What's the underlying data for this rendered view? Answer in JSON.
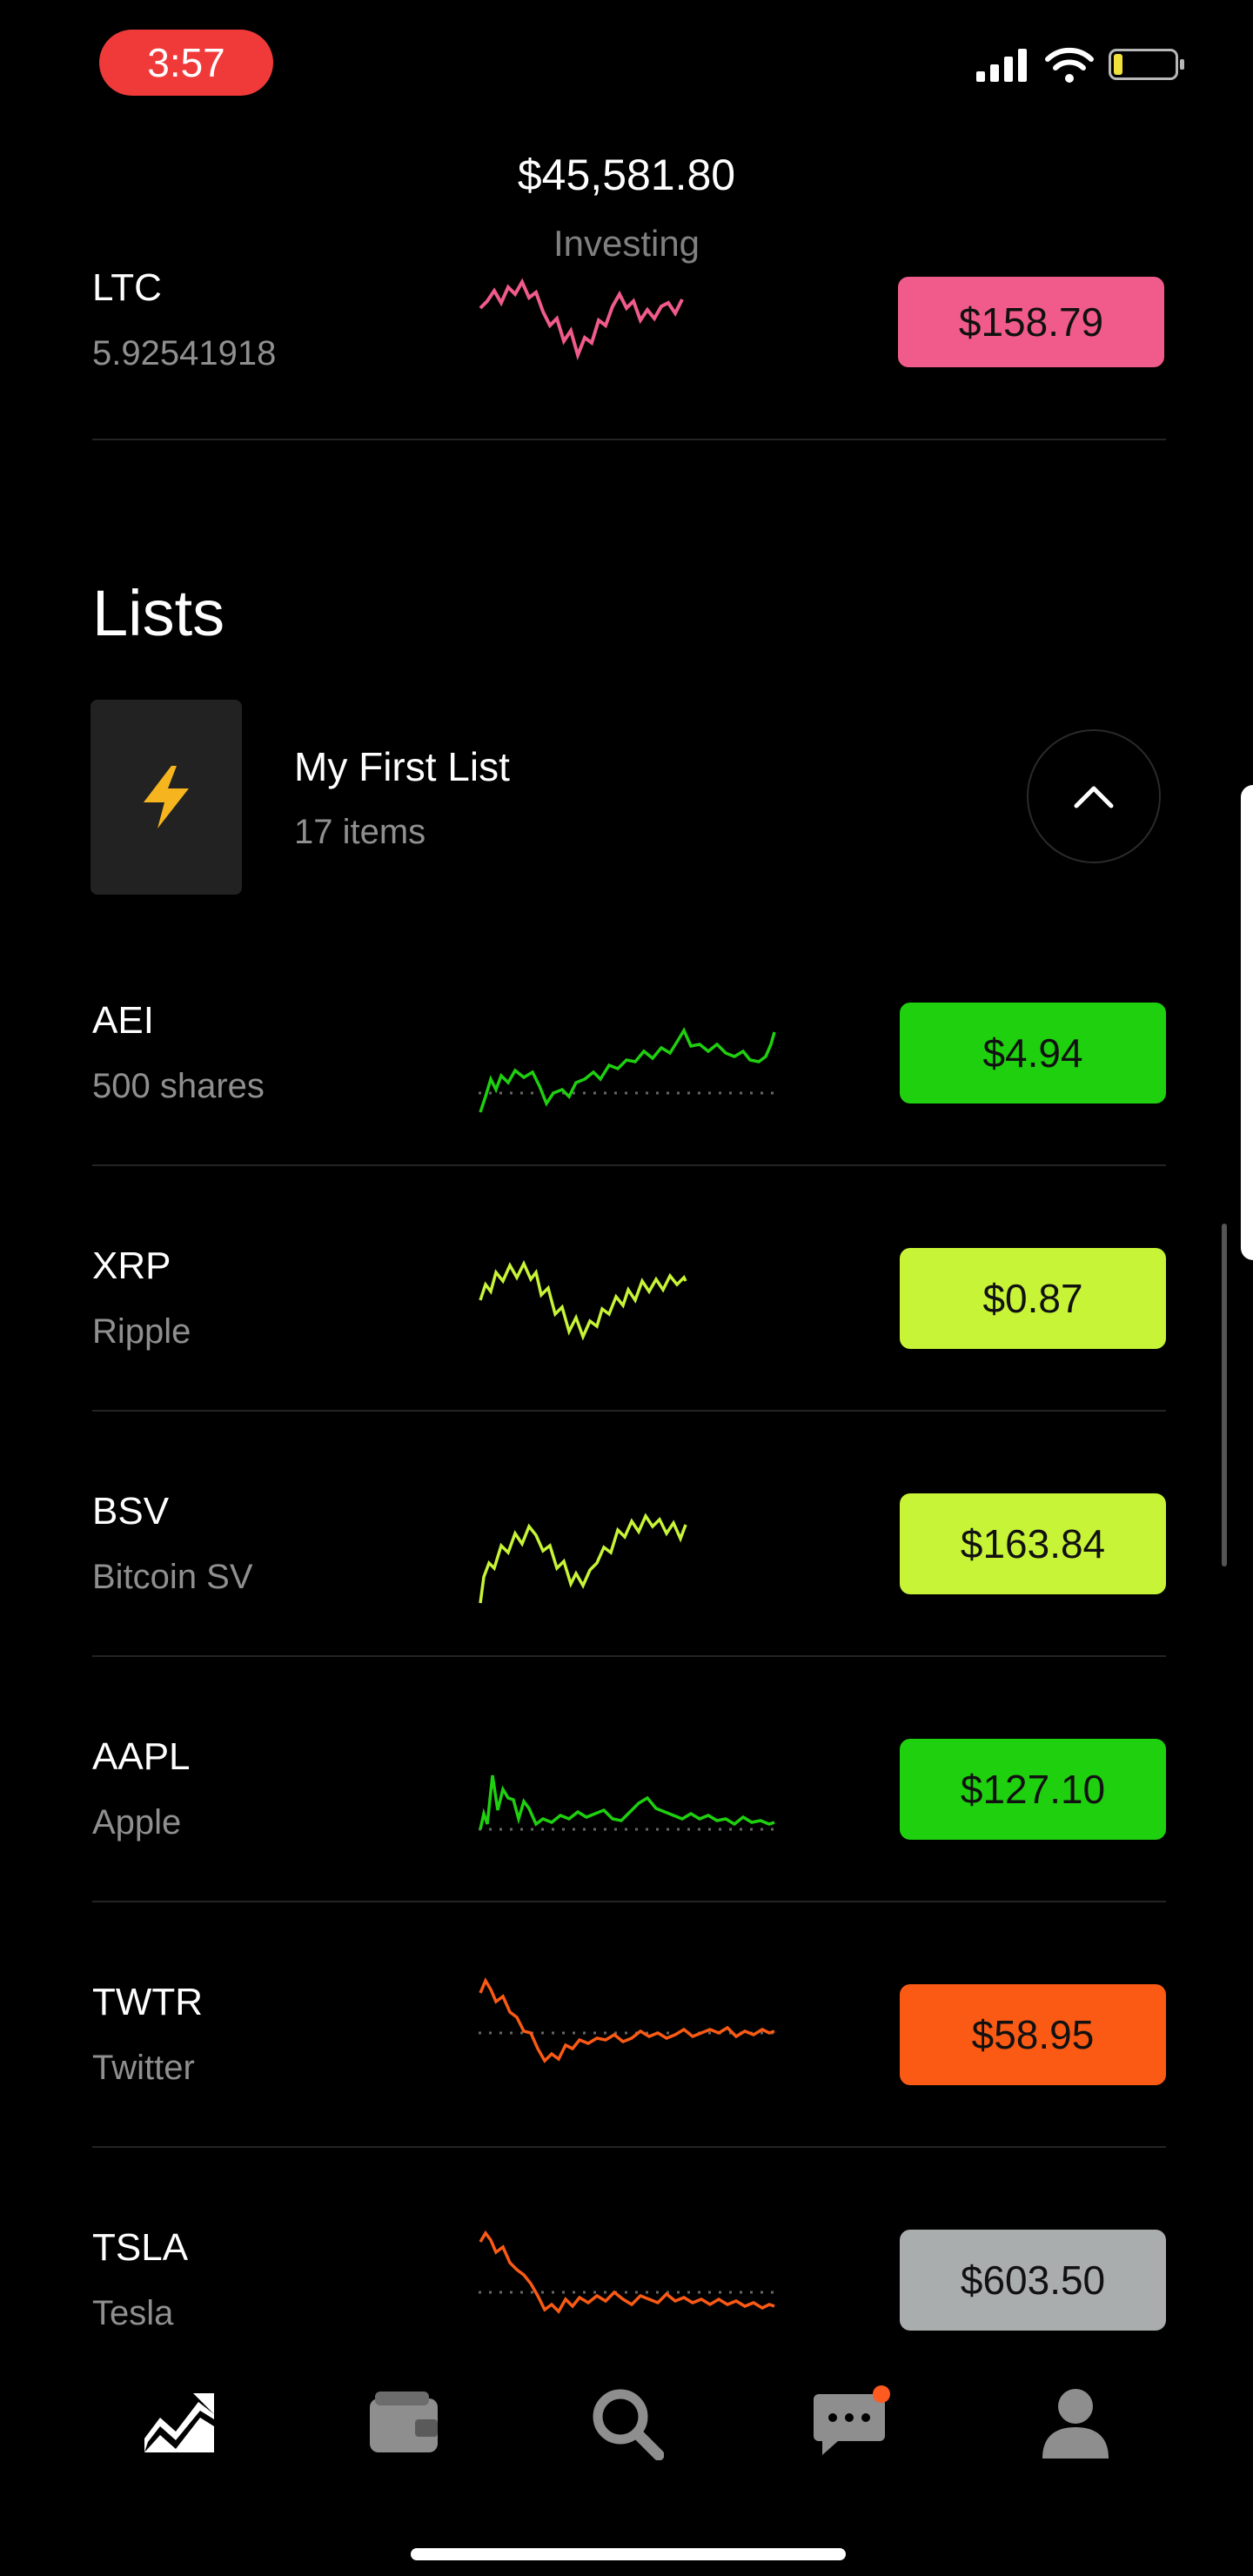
{
  "status_bar": {
    "time": "3:57",
    "time_pill_color": "#f03a3a",
    "icons": [
      "signal-icon",
      "wifi-icon",
      "battery-icon"
    ]
  },
  "header": {
    "portfolio_value": "$45,581.80",
    "label": "Investing"
  },
  "ltc_row": {
    "symbol": "LTC",
    "quantity": "5.92541918",
    "price": "$158.79",
    "color": "#f05b8b"
  },
  "lists": {
    "title": "Lists",
    "list": {
      "icon": "lightning-bolt-icon",
      "name": "My First List",
      "count": "17 items",
      "toggle_icon": "chevron-up-icon"
    },
    "items": [
      {
        "symbol": "AEI",
        "subtitle": "500 shares",
        "price": "$4.94",
        "color": "#1fd00f"
      },
      {
        "symbol": "XRP",
        "subtitle": "Ripple",
        "price": "$0.87",
        "color": "#c7f437"
      },
      {
        "symbol": "BSV",
        "subtitle": "Bitcoin SV",
        "price": "$163.84",
        "color": "#c7f437"
      },
      {
        "symbol": "AAPL",
        "subtitle": "Apple",
        "price": "$127.10",
        "color": "#1fd00f"
      },
      {
        "symbol": "TWTR",
        "subtitle": "Twitter",
        "price": "$58.95",
        "color": "#fa5a14"
      },
      {
        "symbol": "TSLA",
        "subtitle": "Tesla",
        "price": "$603.50",
        "color": "#a9adad"
      }
    ]
  },
  "nav": {
    "items": [
      "stocks-chart-icon",
      "wallet-icon",
      "search-icon",
      "messages-icon",
      "profile-icon"
    ],
    "notification_color": "#ff5a1f"
  }
}
